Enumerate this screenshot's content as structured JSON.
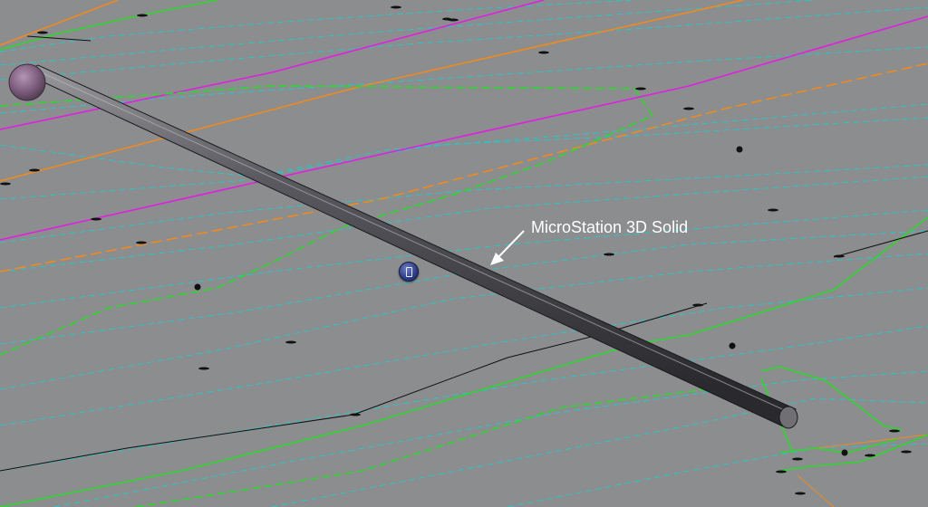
{
  "viewport": {
    "annotation_text": "MicroStation 3D Solid",
    "background_color": "#8b8d8e"
  },
  "colors": {
    "contour_dashed": "#2ec3c7",
    "green_line": "#2fd62f",
    "orange_line": "#f08a20",
    "magenta_line": "#e020e0",
    "black_line": "#111111",
    "pipe_body": "#4c4c52",
    "sphere": "#7a5a7a",
    "handle_button": "#2c3b86"
  },
  "icons": {
    "pipe_start_sphere": "sphere-icon",
    "manipulator_handle": "handle-button-icon",
    "annotation_arrow": "arrow-icon"
  }
}
